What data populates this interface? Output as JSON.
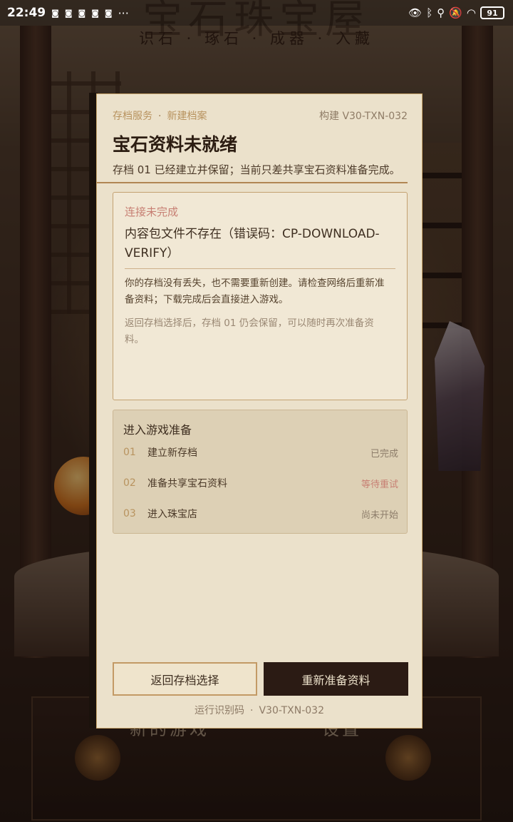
{
  "status_bar": {
    "time": "22:49",
    "notification_icons": [
      "app-notification-icon",
      "app-notification-icon",
      "app-notification-icon",
      "app-notification-icon",
      "app-notification-icon"
    ],
    "more": "···",
    "battery": "91"
  },
  "background": {
    "subtitle": "识石 · 琢石 · 成器 · 入藏",
    "button_left": "新的游戏",
    "button_right": "设置"
  },
  "dialog": {
    "breadcrumb": [
      "存档服务",
      "新建档案"
    ],
    "breadcrumb_sep": "·",
    "build": "构建 V30-TXN-032",
    "title": "宝石资料未就绪",
    "subtitle": "存档 01 已经建立并保留；当前只差共享宝石资料准备完成。",
    "error": {
      "label": "连接未完成",
      "message": "内容包文件不存在（错误码：CP-DOWNLOAD-VERIFY）",
      "description": "你的存档没有丢失，也不需要重新创建。请检查网络后重新准备资料；下载完成后会直接进入游戏。",
      "note": "返回存档选择后，存档 01 仍会保留，可以随时再次准备资料。"
    },
    "steps": {
      "title": "进入游戏准备",
      "items": [
        {
          "num": "01",
          "name": "建立新存档",
          "status": "已完成"
        },
        {
          "num": "02",
          "name": "准备共享宝石资料",
          "status": "等待重试"
        },
        {
          "num": "03",
          "name": "进入珠宝店",
          "status": "尚未开始"
        }
      ]
    },
    "buttons": {
      "back": "返回存档选择",
      "retry": "重新准备资料"
    },
    "runtime": {
      "label": "运行识别码",
      "sep": "·",
      "code": "V30-TXN-032"
    }
  }
}
